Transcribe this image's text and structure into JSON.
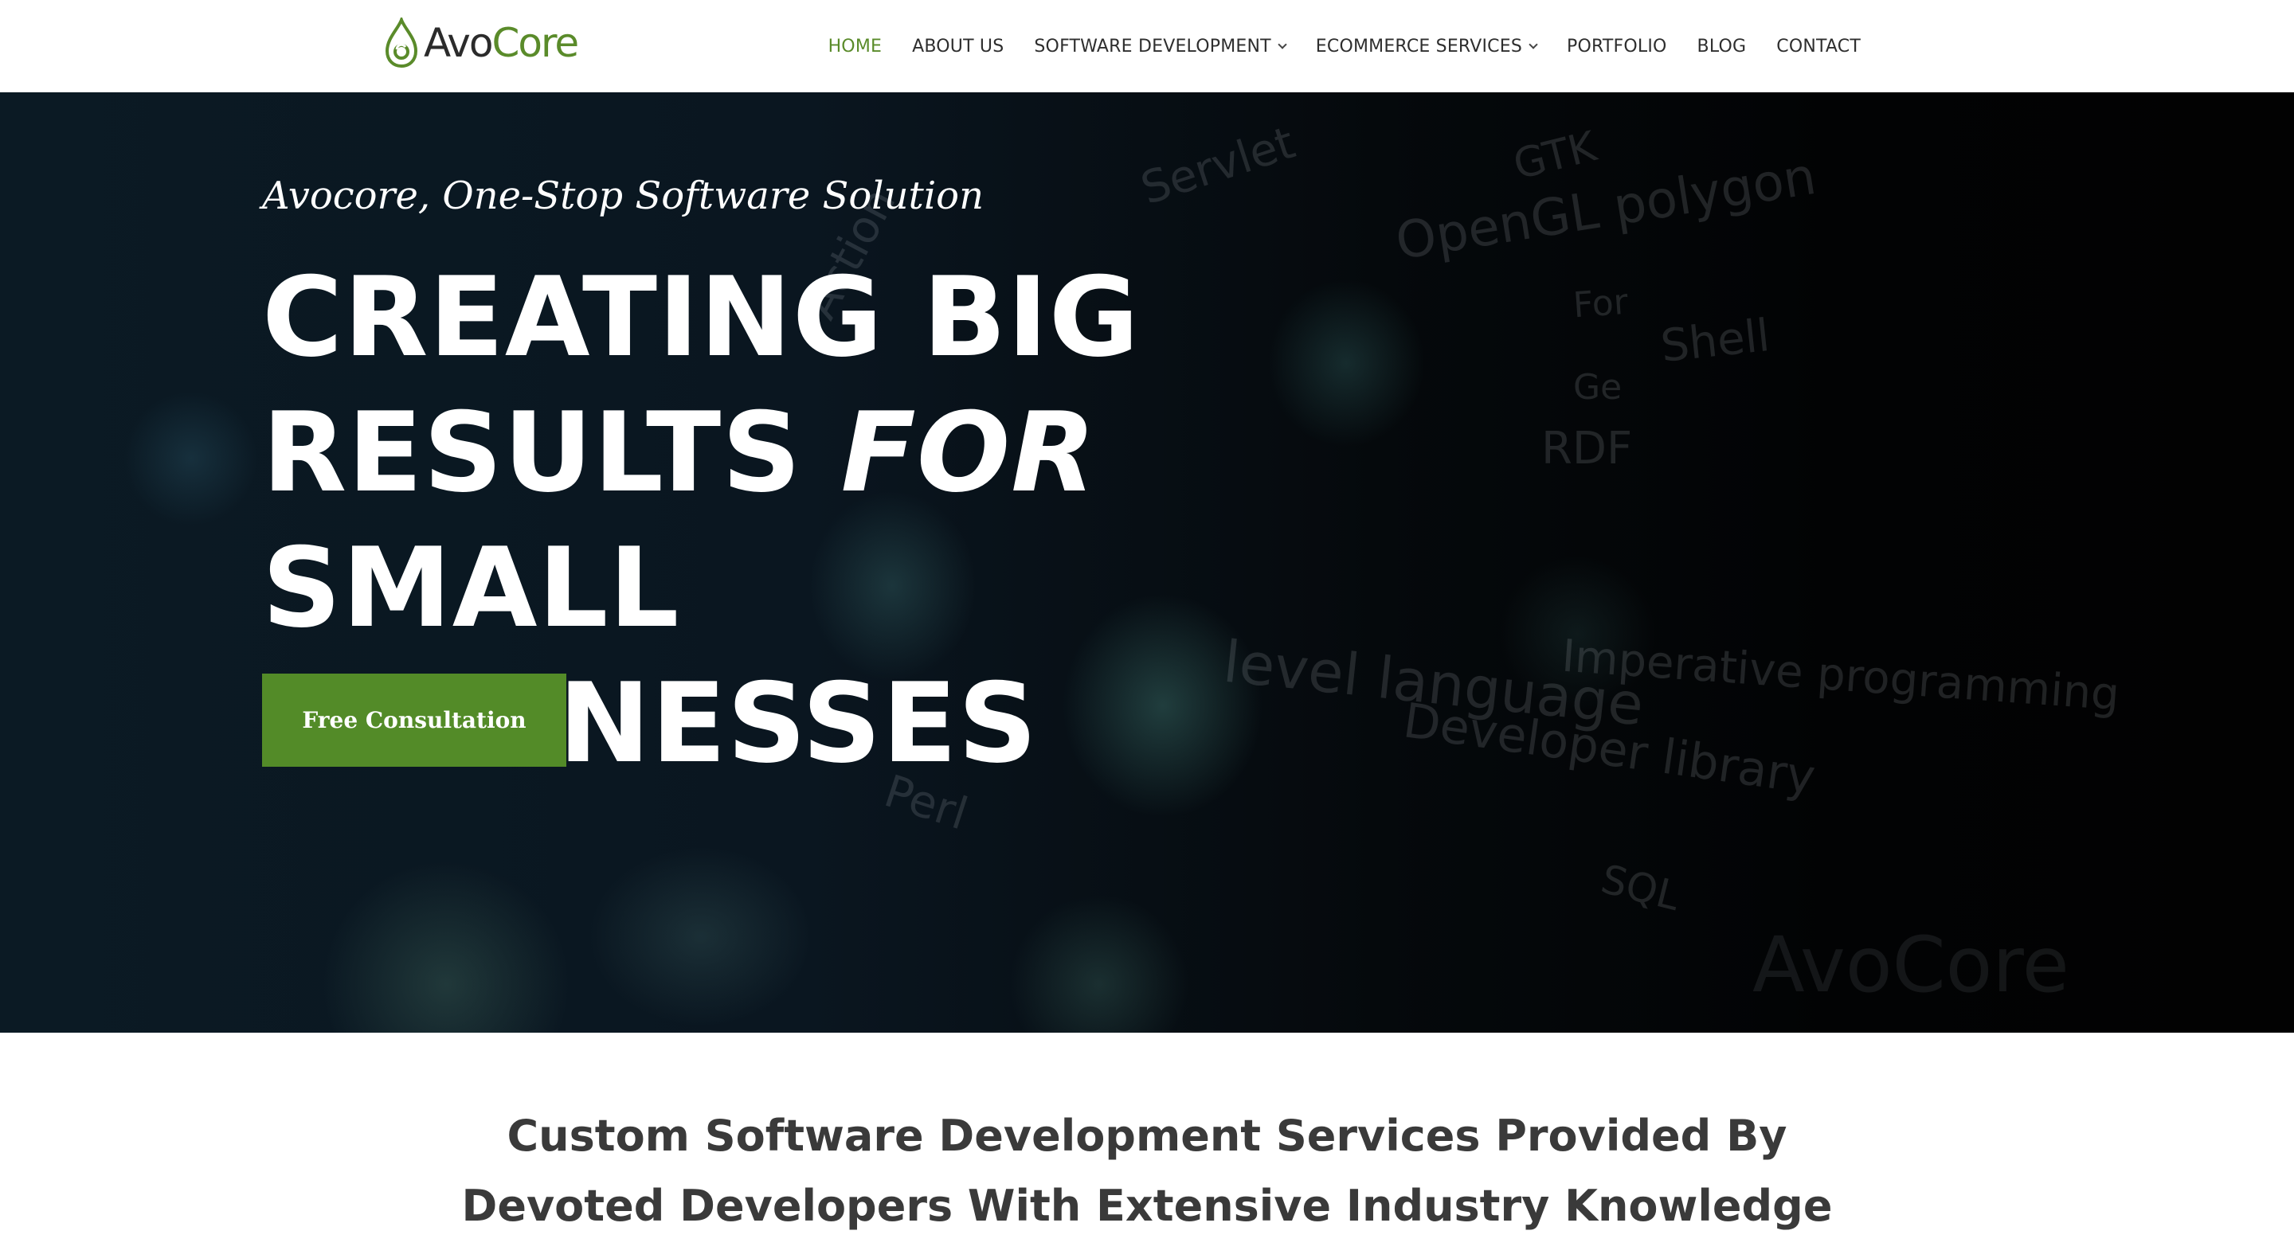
{
  "brand": {
    "name_prefix": "Avo",
    "name_suffix": "Core",
    "accent": "#5a8b2a"
  },
  "nav": {
    "items": [
      {
        "label": "HOME",
        "active": true,
        "has_dropdown": false
      },
      {
        "label": "ABOUT US",
        "active": false,
        "has_dropdown": false
      },
      {
        "label": "SOFTWARE DEVELOPMENT",
        "active": false,
        "has_dropdown": true
      },
      {
        "label": "ECOMMERCE SERVICES",
        "active": false,
        "has_dropdown": true
      },
      {
        "label": "PORTFOLIO",
        "active": false,
        "has_dropdown": false
      },
      {
        "label": "BLOG",
        "active": false,
        "has_dropdown": false
      },
      {
        "label": "CONTACT",
        "active": false,
        "has_dropdown": false
      }
    ]
  },
  "hero": {
    "tagline": "Avocore, One-Stop Software Solution",
    "headline_line1": "CREATING BIG",
    "headline_line2_a": "RESULTS ",
    "headline_line2_em": "FOR",
    "headline_line2_b": " SMALL",
    "headline_line3": "BUSINESSES",
    "cta_label": "Free Consultation",
    "cta_color": "#538b28",
    "background_words": [
      "Servlet",
      "GTK",
      "OpenGL polygon",
      "Shell",
      "For",
      "Ge",
      "RDF",
      "Imperative programming",
      "level language",
      "Developer library",
      "Perl",
      "SQL",
      "AvoCore",
      "Action"
    ]
  },
  "intro": {
    "heading": "Custom Software Development Services Provided By Devoted Developers With Extensive Industry Knowledge"
  }
}
